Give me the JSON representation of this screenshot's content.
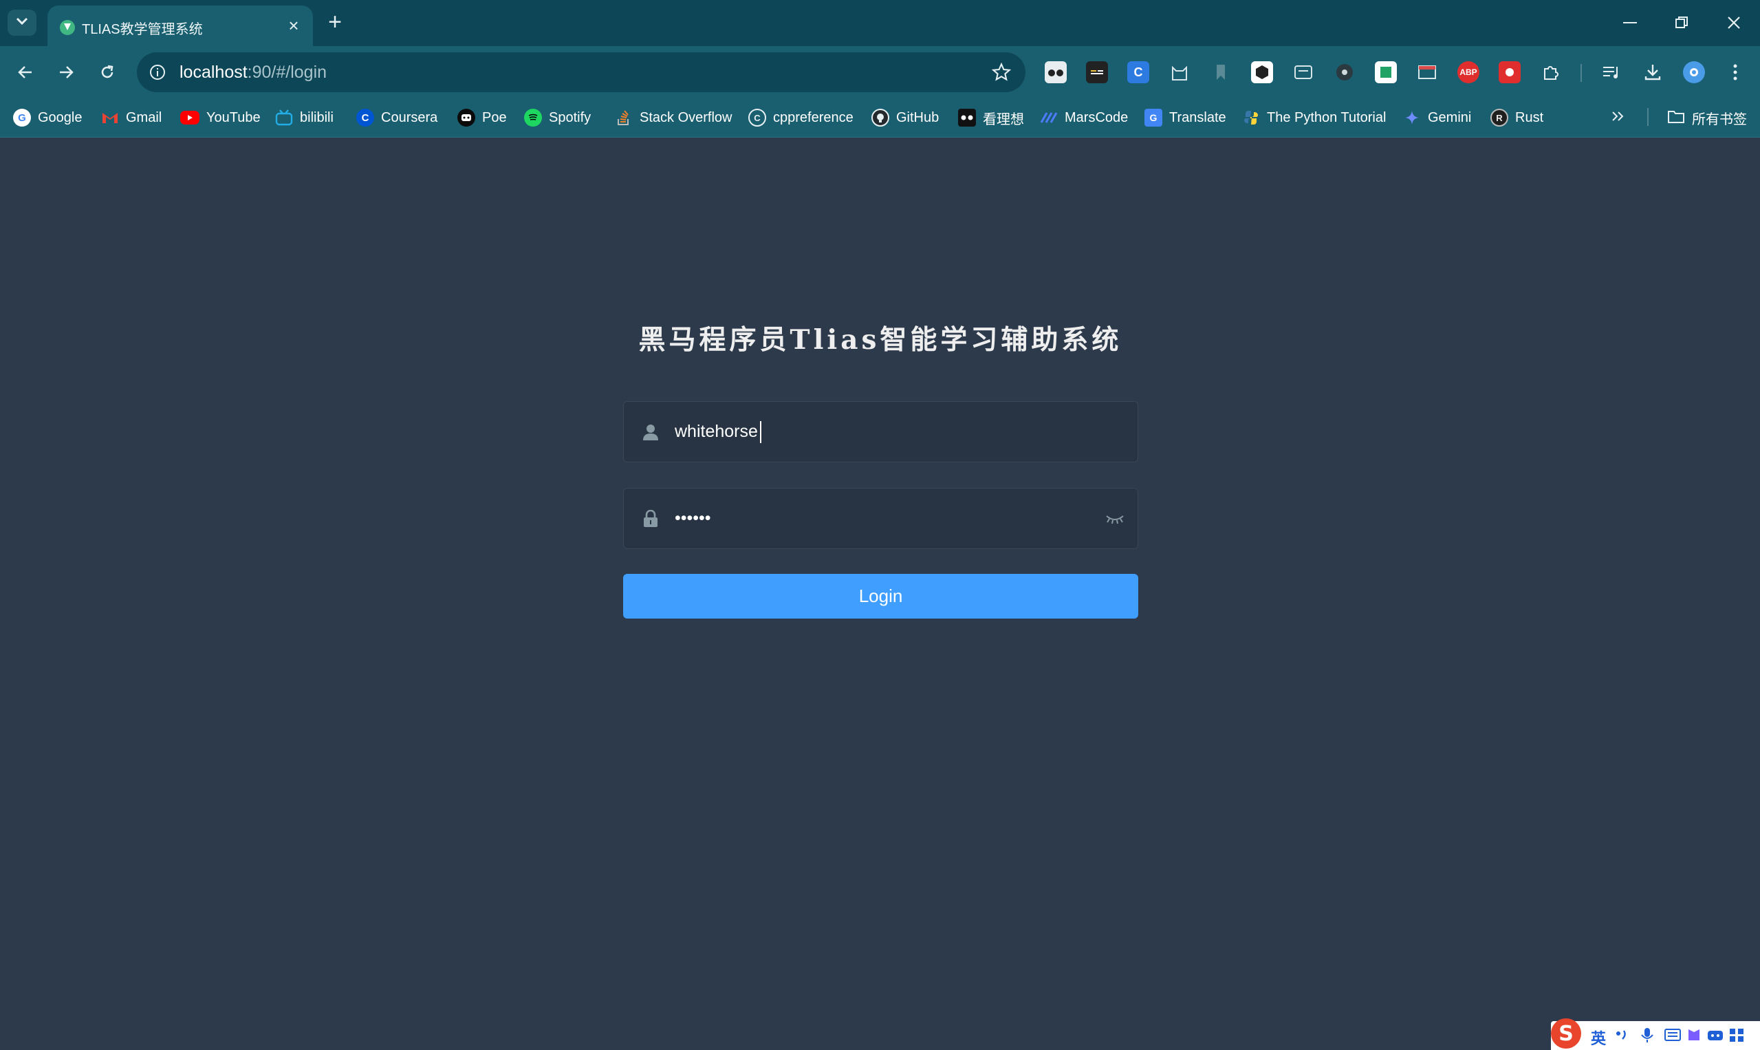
{
  "browser": {
    "tab": {
      "title": "TLIAS教学管理系统"
    },
    "address": {
      "host": "localhost",
      "rest": ":90/#/login"
    },
    "bookmarks": [
      {
        "label": "Google",
        "icon": "google-icon"
      },
      {
        "label": "Gmail",
        "icon": "gmail-icon"
      },
      {
        "label": "YouTube",
        "icon": "youtube-icon"
      },
      {
        "label": "bilibili",
        "icon": "bilibili-icon"
      },
      {
        "label": "Coursera",
        "icon": "coursera-icon"
      },
      {
        "label": "Poe",
        "icon": "poe-icon"
      },
      {
        "label": "Spotify",
        "icon": "spotify-icon"
      },
      {
        "label": "Stack Overflow",
        "icon": "stackoverflow-icon"
      },
      {
        "label": "cppreference",
        "icon": "cppreference-icon"
      },
      {
        "label": "GitHub",
        "icon": "github-icon"
      },
      {
        "label": "看理想",
        "icon": "kanlixiang-icon"
      },
      {
        "label": "MarsCode",
        "icon": "marscode-icon"
      },
      {
        "label": "Translate",
        "icon": "translate-icon"
      },
      {
        "label": "The Python Tutorial",
        "icon": "python-icon"
      },
      {
        "label": "Gemini",
        "icon": "gemini-icon"
      },
      {
        "label": "Rust",
        "icon": "rust-icon"
      }
    ],
    "all_bookmarks_label": "所有书签",
    "extensions": [
      "ABP"
    ]
  },
  "login": {
    "title": "黑马程序员Tlias智能学习辅助系统",
    "username": "whitehorse",
    "password_mask": "••••••",
    "button": "Login"
  },
  "ime": {
    "lang": "英"
  },
  "colors": {
    "page_bg": "#2d3a4b",
    "input_bg": "#283443",
    "button": "#409eff",
    "chrome": "#1a5f70",
    "tabbar": "#0d4656"
  }
}
